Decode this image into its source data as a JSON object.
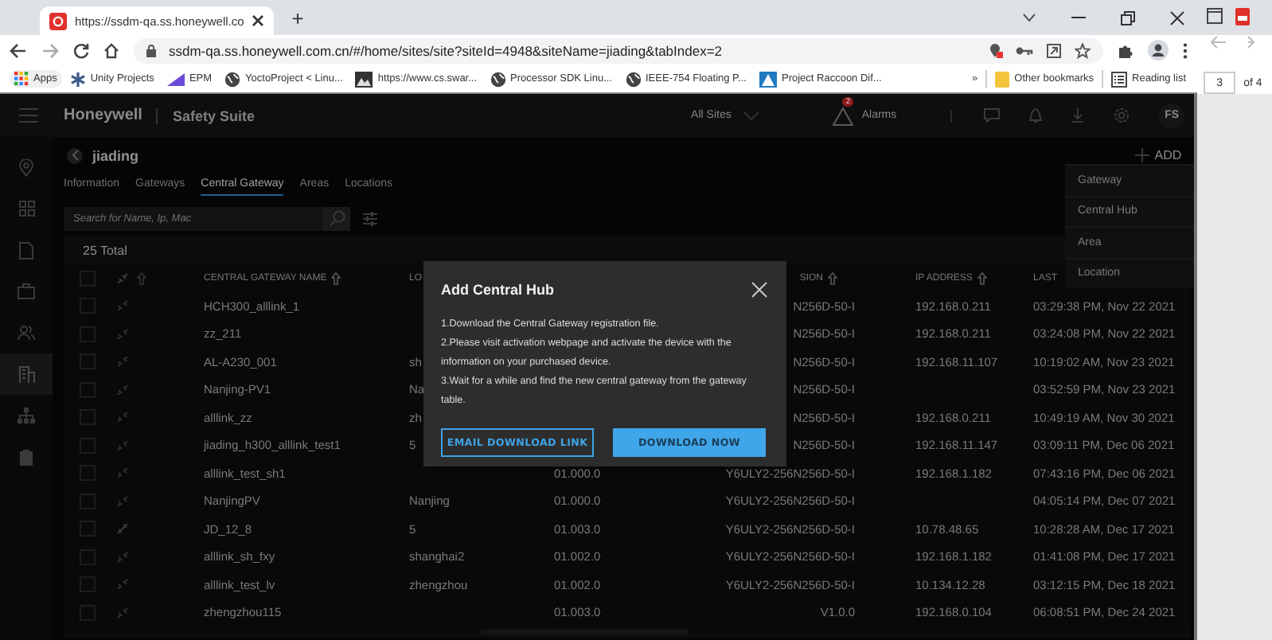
{
  "browser": {
    "tab_title": "https://ssdm-qa.ss.honeywell.co",
    "new_tab": "+",
    "url": "ssdm-qa.ss.honeywell.com.cn/#/home/sites/site?siteId=4948&siteName=jiading&tabIndex=2",
    "bookmarks": [
      {
        "label": "Apps",
        "kind": "apps"
      },
      {
        "label": "Unity Projects",
        "kind": "unity"
      },
      {
        "label": "EPM",
        "kind": "chart"
      },
      {
        "label": "YoctoProject < Linu...",
        "kind": "globe"
      },
      {
        "label": "https://www.cs.swar...",
        "kind": "image"
      },
      {
        "label": "Processor SDK Linu...",
        "kind": "globe"
      },
      {
        "label": "IEEE-754 Floating P...",
        "kind": "globe"
      },
      {
        "label": "Project Raccoon Dif...",
        "kind": "triangle"
      }
    ],
    "overflow": "»",
    "other_bookmarks": "Other bookmarks",
    "reading_list": "Reading list"
  },
  "pdf_viewer": {
    "page": "3",
    "page_count": "of 4"
  },
  "app": {
    "brand": "Honeywell",
    "product": "Safety Suite",
    "site_selector": "All Sites",
    "alarm_count": "2",
    "alarms_label": "Alarms",
    "user_initials": "FS"
  },
  "sidebar": {
    "items": [
      {
        "kind": "pin",
        "selected": false
      },
      {
        "kind": "grid",
        "selected": false
      },
      {
        "kind": "document",
        "selected": false
      },
      {
        "kind": "briefcase",
        "selected": false
      },
      {
        "kind": "people",
        "selected": false
      },
      {
        "kind": "building",
        "selected": true
      },
      {
        "kind": "hierarchy",
        "selected": false
      },
      {
        "kind": "clipboard",
        "selected": false
      }
    ]
  },
  "site": {
    "name": "jiading"
  },
  "tabs": [
    {
      "label": "Information",
      "selected": false
    },
    {
      "label": "Gateways",
      "selected": false
    },
    {
      "label": "Central Gateway",
      "selected": true
    },
    {
      "label": "Areas",
      "selected": false
    },
    {
      "label": "Locations",
      "selected": false
    }
  ],
  "search": {
    "placeholder": "Search for Name, Ip, Mac"
  },
  "add_button": "ADD",
  "add_menu": [
    {
      "label": "Gateway"
    },
    {
      "label": "Central Hub"
    },
    {
      "label": "Area"
    },
    {
      "label": "Location"
    }
  ],
  "table": {
    "total": "25 Total",
    "select_all_checked": false,
    "columns": [
      {
        "label": "CENTRAL GATEWAY NAME",
        "sortable": true
      },
      {
        "label": "LO",
        "sortable": false
      },
      {},
      {
        "label": "SION",
        "sortable": true
      },
      {
        "label": "IP ADDRESS",
        "sortable": true
      },
      {
        "label": "LAST",
        "sortable": false
      }
    ],
    "rows": [
      {
        "checked": false,
        "linked": false,
        "cells": [
          "HCH300_alllink_1",
          null,
          null,
          "N256D-50-I",
          "192.168.0.211",
          "03:29:38 PM, Nov 22 2021"
        ]
      },
      {
        "checked": false,
        "linked": false,
        "cells": [
          "zz_211",
          null,
          null,
          "N256D-50-I",
          "192.168.0.211",
          "03:24:08 PM, Nov 22 2021"
        ]
      },
      {
        "checked": false,
        "linked": false,
        "cells": [
          "AL-A230_001",
          "sh",
          null,
          "N256D-50-I",
          "192.168.11.107",
          "10:19:02 AM, Nov 23 2021"
        ]
      },
      {
        "checked": false,
        "linked": false,
        "cells": [
          "Nanjing-PV1",
          "Na",
          null,
          "N256D-50-I",
          null,
          "03:52:59 PM, Nov 23 2021"
        ]
      },
      {
        "checked": false,
        "linked": false,
        "cells": [
          "alllink_zz",
          "zh",
          null,
          "N256D-50-I",
          "192.168.0.211",
          "10:49:19 AM, Nov 30 2021"
        ]
      },
      {
        "checked": false,
        "linked": false,
        "cells": [
          "jiading_h300_alllink_test1",
          "5",
          null,
          "N256D-50-I",
          "192.168.11.147",
          "03:09:11 PM, Dec 06 2021"
        ]
      },
      {
        "checked": false,
        "linked": false,
        "cells": [
          "alllink_test_sh1",
          null,
          "01.000.0",
          "Y6ULY2-256N256D-50-I",
          "192.168.1.182",
          "07:43:16 PM, Dec 06 2021"
        ]
      },
      {
        "checked": false,
        "linked": false,
        "cells": [
          "NanjingPV",
          "Nanjing",
          "01.000.0",
          "Y6ULY2-256N256D-50-I",
          null,
          "04:05:14 PM, Dec 07 2021"
        ]
      },
      {
        "checked": false,
        "linked": true,
        "cells": [
          "JD_12_8",
          "5",
          "01.003.0",
          "Y6ULY2-256N256D-50-I",
          "10.78.48.65",
          "10:28:28 AM, Dec 17 2021"
        ]
      },
      {
        "checked": false,
        "linked": false,
        "cells": [
          "alllink_sh_fxy",
          "shanghai2",
          "01.002.0",
          "Y6ULY2-256N256D-50-I",
          "192.168.1.182",
          "01:41:08 PM, Dec 17 2021"
        ]
      },
      {
        "checked": false,
        "linked": false,
        "cells": [
          "alllink_test_lv",
          "zhengzhou",
          "01.002.0",
          "Y6ULY2-256N256D-50-I",
          "10.134.12.28",
          "03:12:15 PM, Dec 18 2021"
        ]
      },
      {
        "checked": false,
        "linked": false,
        "cells": [
          "zhengzhou115",
          null,
          "01.003.0",
          "V1.0.0",
          "192.168.0.104",
          "06:08:51 PM, Dec 24 2021"
        ]
      }
    ]
  },
  "dialog": {
    "title": "Add Central Hub",
    "steps": [
      "1.Download the Central Gateway registration file.",
      "2.Please visit activation webpage and activate the device with the information on your purchased device.",
      "3.Wait for a while and find the new central gateway from the gateway table."
    ],
    "buttons": [
      {
        "label": "EMAIL DOWNLOAD LINK",
        "kind": "outline"
      },
      {
        "label": "DOWNLOAD NOW",
        "kind": "primary"
      }
    ]
  }
}
